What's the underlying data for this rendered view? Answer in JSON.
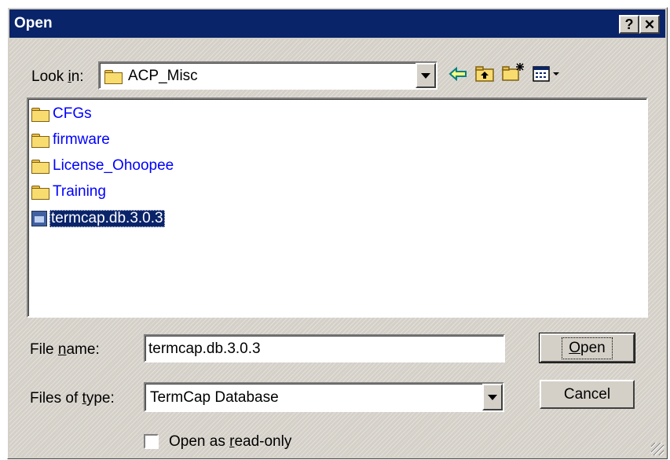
{
  "window": {
    "title": "Open",
    "help_label": "?",
    "close_label": "✕"
  },
  "look_in": {
    "label_pre": "Look ",
    "label_mnemonic": "i",
    "label_post": "n:",
    "value": "ACP_Misc",
    "folder_icon": "folder-icon"
  },
  "toolbar": {
    "back_icon": "back-arrow-icon",
    "up_icon": "up-folder-icon",
    "new_folder_icon": "new-folder-icon",
    "view_menu_icon": "view-menu-icon"
  },
  "files": [
    {
      "name": "CFGs",
      "type": "folder"
    },
    {
      "name": "firmware",
      "type": "folder"
    },
    {
      "name": "License_Ohoopee",
      "type": "folder"
    },
    {
      "name": "Training",
      "type": "folder"
    },
    {
      "name": "termcap.db.3.0.3",
      "type": "file",
      "selected": true
    }
  ],
  "file_name": {
    "label_pre": "File ",
    "label_mnemonic": "n",
    "label_post": "ame:",
    "value": "termcap.db.3.0.3"
  },
  "file_type": {
    "label_pre": "Files of ",
    "label_mnemonic": "t",
    "label_post": "ype:",
    "value": "TermCap Database"
  },
  "buttons": {
    "open_mnemonic": "O",
    "open_rest": "pen",
    "cancel_label": "Cancel"
  },
  "read_only": {
    "label_pre": "Open as ",
    "label_mnemonic": "r",
    "label_post": "ead-only",
    "checked": false
  },
  "colors": {
    "titlebar": "#0a246a",
    "face": "#d4d0c8",
    "selection": "#0a246a",
    "link_text": "#0000ff"
  }
}
